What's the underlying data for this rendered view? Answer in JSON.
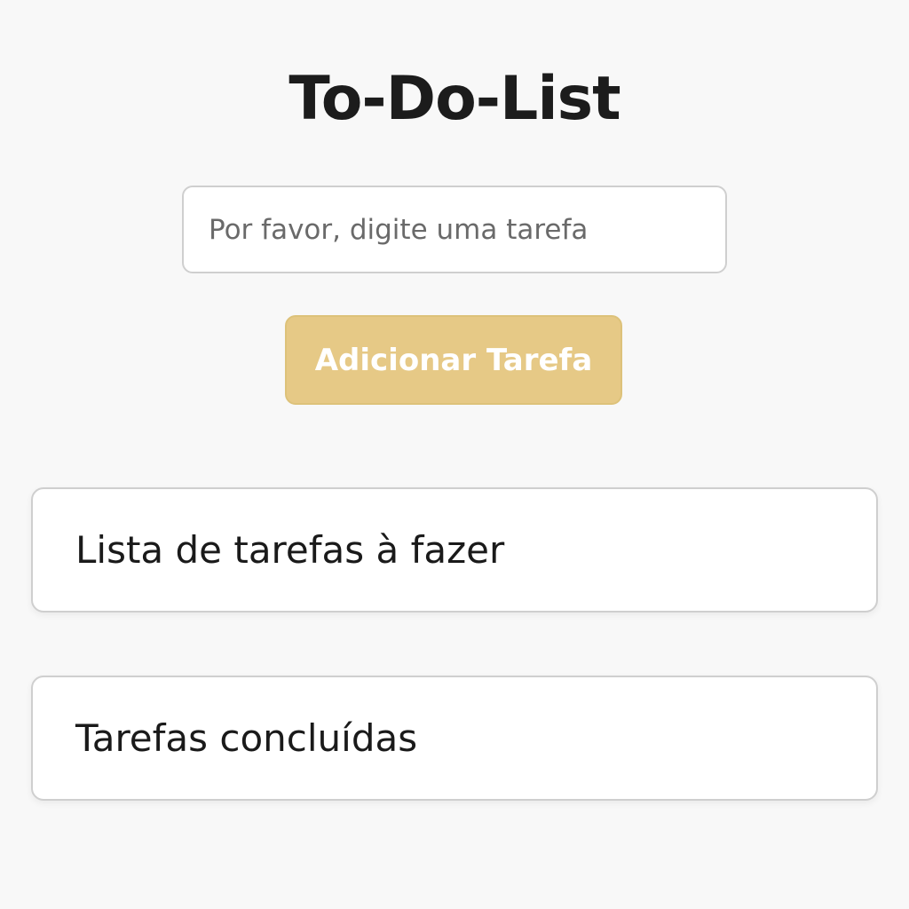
{
  "app": {
    "title": "To-Do-List"
  },
  "form": {
    "input_value": "",
    "input_placeholder": "Por favor, digite uma tarefa",
    "add_button_label": "Adicionar Tarefa"
  },
  "lists": {
    "todo_title": "Lista de tarefas à fazer",
    "done_title": "Tarefas concluídas"
  },
  "colors": {
    "accent": "#e6c986",
    "background": "#f8f8f8"
  }
}
